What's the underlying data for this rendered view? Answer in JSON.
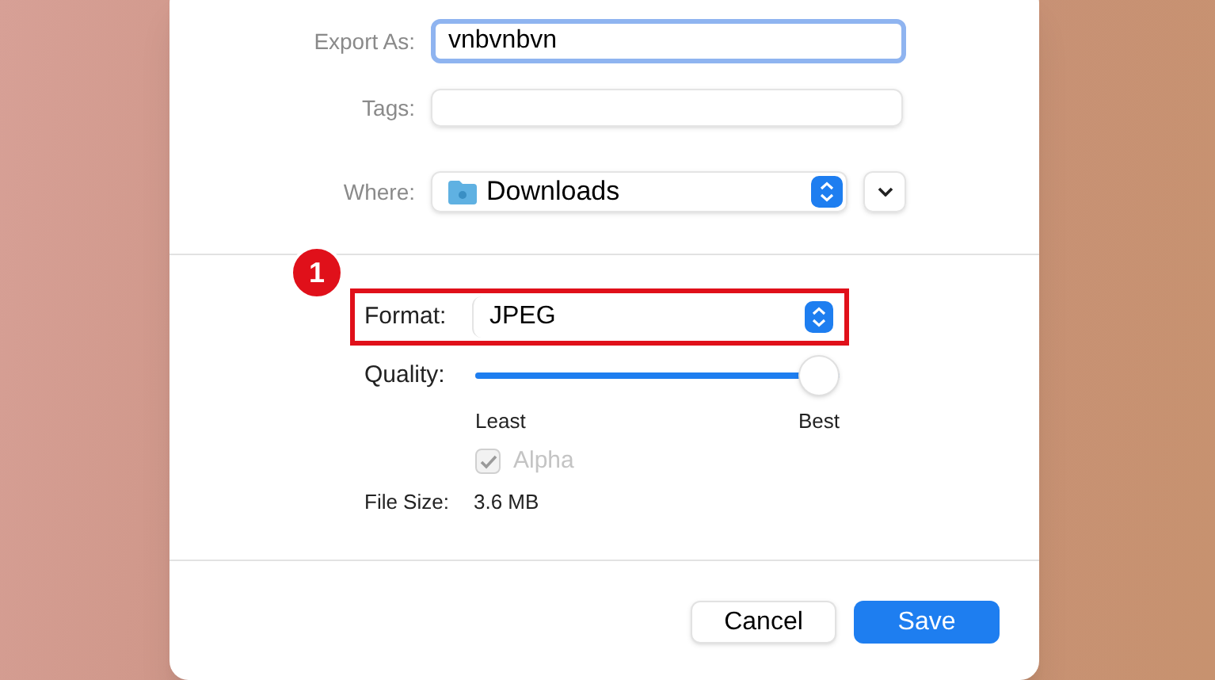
{
  "export_as": {
    "label": "Export As:",
    "value": "vnbvnbvn",
    "focused": true
  },
  "tags": {
    "label": "Tags:"
  },
  "where": {
    "label": "Where:",
    "value": "Downloads"
  },
  "format": {
    "label": "Format:",
    "value": "JPEG",
    "highlighted": true,
    "badge": "1"
  },
  "quality": {
    "label": "Quality:",
    "level": 1,
    "min_label": "Least",
    "max_label": "Best"
  },
  "alpha": {
    "label": "Alpha",
    "checked": true,
    "disabled": true
  },
  "file_size": {
    "label": "File Size:",
    "value": "3.6 MB"
  },
  "buttons": [
    {
      "label": "Cancel",
      "kind": "secondary"
    },
    {
      "label": "Save",
      "kind": "primary"
    }
  ]
}
